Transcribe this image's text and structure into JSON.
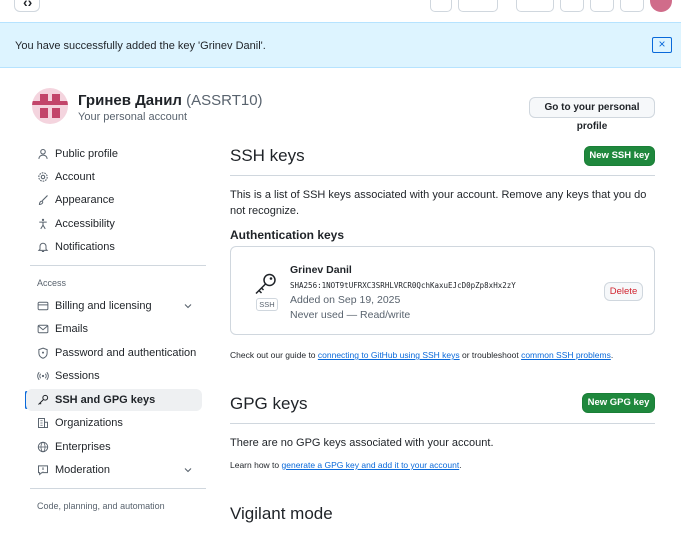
{
  "flash": {
    "message": "You have successfully added the key 'Grinev Danil'.",
    "close_icon": "×"
  },
  "header": {
    "name": "Гринев Данил",
    "login": "(ASSRT10)",
    "subtitle": "Your personal account",
    "profile_button": "Go to your personal profile"
  },
  "sidebar": {
    "items": [
      {
        "label": "Public profile",
        "icon": "person-icon"
      },
      {
        "label": "Account",
        "icon": "gear-icon"
      },
      {
        "label": "Appearance",
        "icon": "paintbrush-icon"
      },
      {
        "label": "Accessibility",
        "icon": "accessibility-icon"
      },
      {
        "label": "Notifications",
        "icon": "bell-icon"
      }
    ],
    "access_heading": "Access",
    "access_items": [
      {
        "label": "Billing and licensing",
        "icon": "credit-card-icon"
      },
      {
        "label": "Emails",
        "icon": "mail-icon"
      },
      {
        "label": "Password and authentication",
        "icon": "shield-lock-icon"
      },
      {
        "label": "Sessions",
        "icon": "broadcast-icon"
      },
      {
        "label": "SSH and GPG keys",
        "icon": "key-icon"
      },
      {
        "label": "Organizations",
        "icon": "organization-icon"
      },
      {
        "label": "Enterprises",
        "icon": "globe-icon"
      },
      {
        "label": "Moderation",
        "icon": "report-icon"
      }
    ],
    "code_heading": "Code, planning, and automation"
  },
  "ssh": {
    "title": "SSH keys",
    "new_button": "New SSH key",
    "description": "This is a list of SSH keys associated with your account. Remove any keys that you do not recognize.",
    "auth_heading": "Authentication keys",
    "key": {
      "title": "Grinev Danil",
      "fingerprint": "SHA256:1NOT9tUFRXC3SRHLVRCR0QchKaxuEJcD0pZp8xHx2zY",
      "added": "Added on Sep 19, 2025",
      "usage": "Never used — Read/write",
      "badge": "SSH",
      "delete_button": "Delete"
    },
    "footer_prefix": "Check out our guide to ",
    "footer_link1": "connecting to GitHub using SSH keys",
    "footer_middle": " or troubleshoot ",
    "footer_link2": "common SSH problems",
    "footer_suffix": "."
  },
  "gpg": {
    "title": "GPG keys",
    "new_button": "New GPG key",
    "empty_message": "There are no GPG keys associated with your account.",
    "learn_prefix": "Learn how to ",
    "learn_link": "generate a GPG key and add it to your account",
    "learn_suffix": "."
  },
  "vigilant": {
    "title": "Vigilant mode"
  },
  "colors": {
    "accent": "#0969da",
    "primary_button": "#1f883d",
    "danger": "#d1242f",
    "flash_bg": "#ddf4ff"
  }
}
